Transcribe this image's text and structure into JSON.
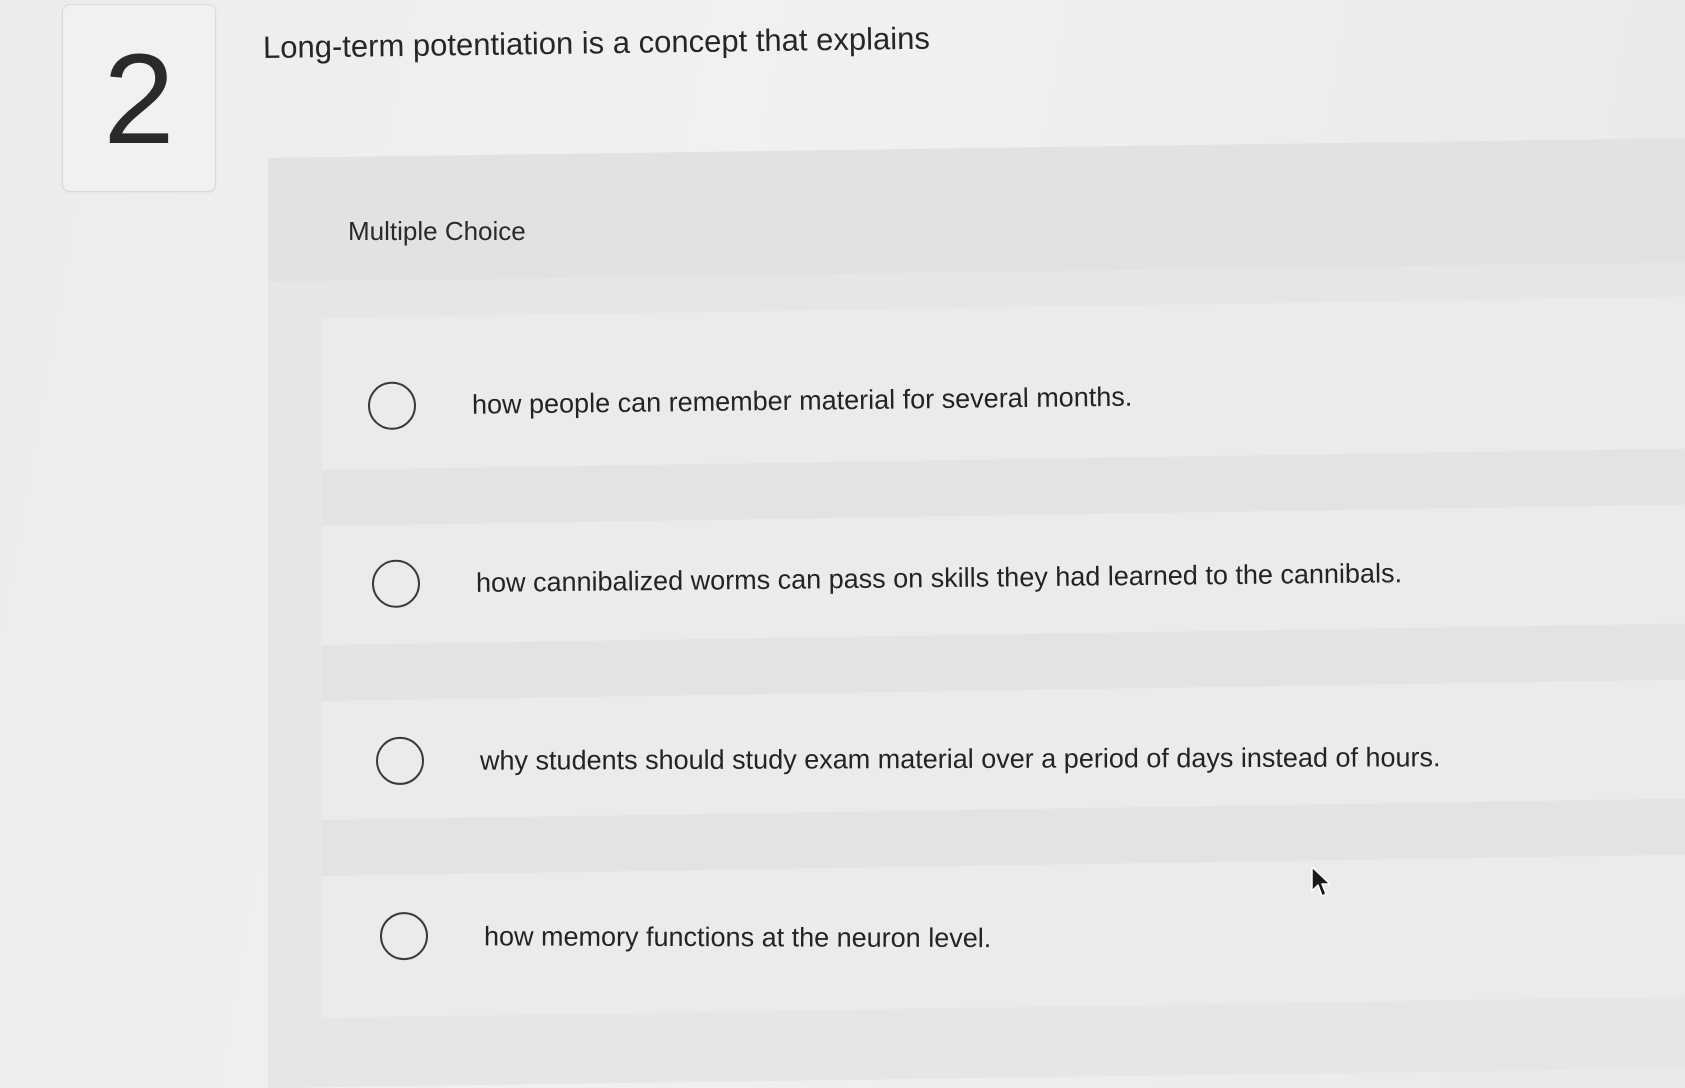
{
  "question": {
    "number": "2",
    "prompt": "Long-term potentiation is a concept that explains"
  },
  "multiple_choice": {
    "label": "Multiple Choice",
    "options": [
      {
        "text": "how people can remember material for several months."
      },
      {
        "text": "how cannibalized worms can pass on skills they had learned to the cannibals."
      },
      {
        "text": "why students should study exam material over a period of days instead of hours."
      },
      {
        "text": "how memory functions at the neuron level."
      }
    ]
  },
  "icons": {
    "radio": "radio-button-icon",
    "cursor": "mouse-pointer-icon"
  },
  "colors": {
    "background": "#efefef",
    "panel": "#e6e6e6",
    "text": "#232323",
    "radio_border": "#3a3a3a"
  }
}
